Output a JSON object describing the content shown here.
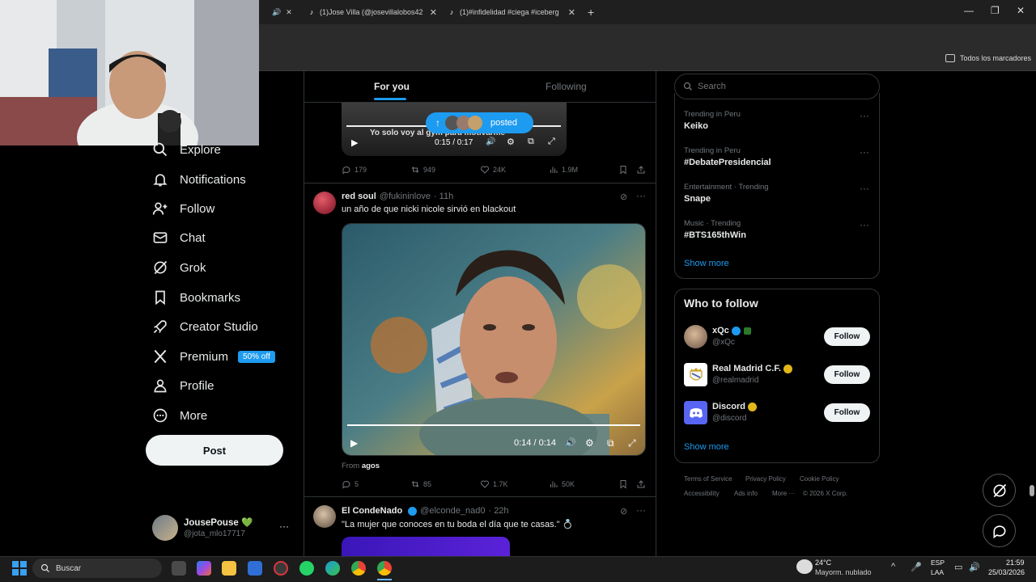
{
  "browser": {
    "tabs": [
      {
        "title": "(1)Jose Villa (@josevillalobos42"
      },
      {
        "title": "(1)#infidelidad #ciega #iceberg"
      }
    ],
    "new_tab": "+",
    "bookmarks_label": "Todos los marcadores",
    "win_controls": [
      "—",
      "❐",
      "✕"
    ]
  },
  "nav": {
    "items": [
      {
        "label": "Explore",
        "icon": "search-icon"
      },
      {
        "label": "Notifications",
        "icon": "bell-icon"
      },
      {
        "label": "Follow",
        "icon": "add-person-icon"
      },
      {
        "label": "Chat",
        "icon": "mail-icon"
      },
      {
        "label": "Grok",
        "icon": "grok-icon"
      },
      {
        "label": "Bookmarks",
        "icon": "bookmark-icon"
      },
      {
        "label": "Creator Studio",
        "icon": "rocket-icon"
      },
      {
        "label": "Premium",
        "icon": "x-logo-icon"
      },
      {
        "label": "Profile",
        "icon": "person-icon"
      },
      {
        "label": "More",
        "icon": "more-circle-icon"
      }
    ],
    "premium_badge": "50% off",
    "post_label": "Post",
    "account": {
      "name": "JousePouse 💚",
      "handle": "@jota_mlo17717",
      "more": "···"
    }
  },
  "feed": {
    "tabs": [
      {
        "label": "For you",
        "active": true
      },
      {
        "label": "Following",
        "active": false
      }
    ],
    "posted_pill": "posted",
    "post1": {
      "video_caption": "Yo solo voy al gym para motivarme",
      "time": "0:15 / 0:17",
      "stats": {
        "replies": "179",
        "reposts": "949",
        "likes": "24K",
        "views": "1.9M"
      }
    },
    "post2": {
      "name": "red soul",
      "handle": "@fukininlove",
      "age": "· 11h",
      "text": "un año de que nicki nicole sirvió en blackout",
      "time": "0:14 / 0:14",
      "from_label": "From",
      "from_source": "agos",
      "stats": {
        "replies": "5",
        "reposts": "85",
        "likes": "1.7K",
        "views": "50K"
      }
    },
    "post3": {
      "name": "El CondeNado",
      "handle": "@elconde_nad0",
      "age": "· 22h",
      "text": "\"La mujer que conoces en tu boda el día que te casas.\" 💍"
    }
  },
  "right": {
    "search_placeholder": "Search",
    "trends": [
      {
        "category": "Trending in Peru",
        "name": "Keiko"
      },
      {
        "category": "Trending in Peru",
        "name": "#DebatePresidencial"
      },
      {
        "category": "Entertainment · Trending",
        "name": "Snape"
      },
      {
        "category": "Music · Trending",
        "name": "#BTS165thWin"
      }
    ],
    "trends_more": "Show more",
    "wtf_title": "Who to follow",
    "wtf": [
      {
        "name": "xQc",
        "handle": "@xQc",
        "button": "Follow",
        "badge_color": "#1d9bf0"
      },
      {
        "name": "Real Madrid C.F.",
        "handle": "@realmadrid",
        "button": "Follow",
        "badge_color": "#e2b719"
      },
      {
        "name": "Discord",
        "handle": "@discord",
        "button": "Follow",
        "badge_color": "#e2b719"
      }
    ],
    "wtf_more": "Show more",
    "footer": [
      "Terms of Service",
      "Privacy Policy",
      "Cookie Policy",
      "Accessibility",
      "Ads info",
      "More ···",
      "© 2026 X Corp."
    ]
  },
  "taskbar": {
    "search_label": "Buscar",
    "weather_temp": "24°C",
    "weather_desc": "Mayorm. nublado",
    "lang_top": "ESP",
    "lang_bottom": "LAA",
    "time": "21:59",
    "date": "25/03/2026"
  },
  "colors": {
    "accent": "#1d9bf0",
    "bg": "#000000",
    "border": "#2f3336",
    "muted": "#71767b"
  }
}
